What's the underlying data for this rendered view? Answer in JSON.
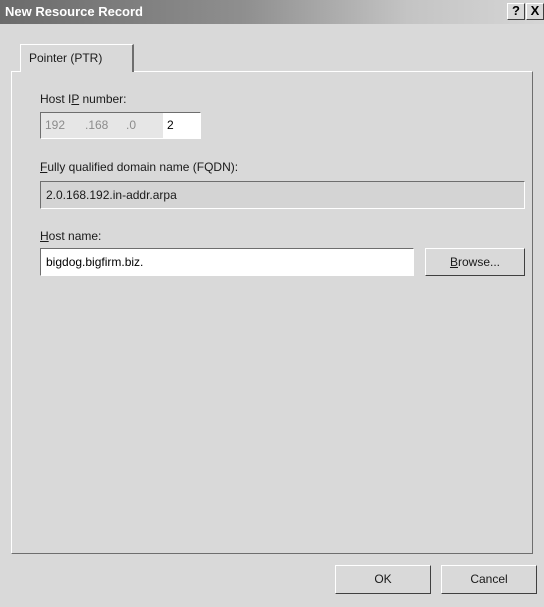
{
  "window": {
    "title": "New Resource Record",
    "help_label": "?",
    "close_label": "X"
  },
  "tabs": [
    {
      "label": "Pointer (PTR)",
      "selected": true
    }
  ],
  "host_ip": {
    "label": "Host IP number:",
    "octets": [
      "192",
      ".168",
      ".0"
    ],
    "value": "2"
  },
  "fqdn": {
    "label": "Fully qualified domain name (FQDN):",
    "value": "2.0.168.192.in-addr.arpa"
  },
  "host_name": {
    "label": "Host name:",
    "value": "bigdog.bigfirm.biz.",
    "browse_label": "Browse..."
  },
  "footer": {
    "ok_label": "OK",
    "cancel_label": "Cancel"
  }
}
